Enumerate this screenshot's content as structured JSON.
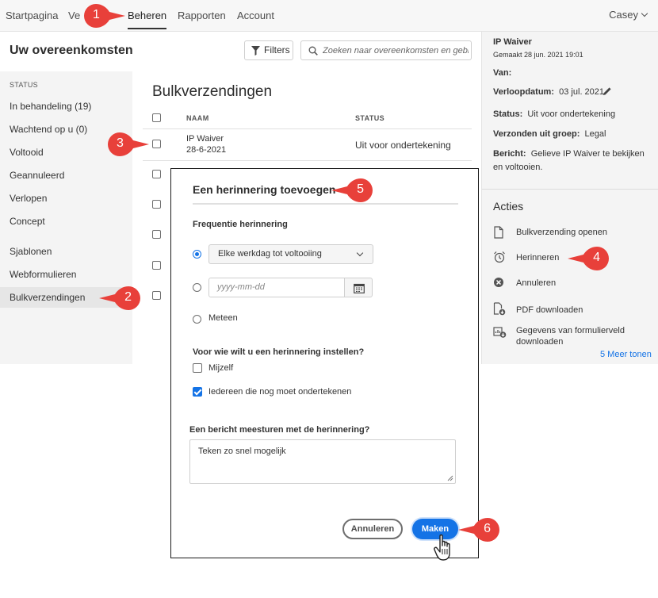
{
  "topnav": {
    "tabs": [
      "Startpagina",
      "Ve",
      "Beheren",
      "Rapporten",
      "Account"
    ],
    "active_tab": "Beheren",
    "user": "Casey"
  },
  "header": {
    "title": "Uw overeenkomsten",
    "filters_label": "Filters",
    "search_placeholder": "Zoeken naar overeenkomsten en gebr..."
  },
  "sidebar": {
    "section": "STATUS",
    "items": [
      "In behandeling (19)",
      "Wachtend op u (0)",
      "Voltooid",
      "Geannuleerd",
      "Verlopen",
      "Concept",
      "Sjablonen",
      "Webformulieren",
      "Bulkverzendingen"
    ],
    "selected": "Bulkverzendingen"
  },
  "table": {
    "title": "Bulkverzendingen",
    "columns": [
      "NAAM",
      "STATUS"
    ],
    "rows": [
      {
        "name": "IP Waiver",
        "date": "28-6-2021",
        "status": "Uit voor ondertekening"
      }
    ]
  },
  "details": {
    "title": "IP Waiver",
    "created": "Gemaakt 28 jun. 2021 19:01",
    "from_label": "Van:",
    "expiry_label": "Verloopdatum:",
    "expiry_value": "03 jul. 2021",
    "status_label": "Status:",
    "status_value": "Uit voor ondertekening",
    "group_label": "Verzonden uit groep:",
    "group_value": "Legal",
    "message_label": "Bericht:",
    "message_value": "Gelieve IP Waiver te bekijken en voltooien."
  },
  "actions": {
    "title": "Acties",
    "items": [
      "Bulkverzending openen",
      "Herinneren",
      "Annuleren",
      "PDF downloaden",
      "Gegevens van formulierveld downloaden"
    ],
    "more": "5 Meer tonen"
  },
  "dialog": {
    "title": "Een herinnering toevoegen",
    "frequency_label": "Frequentie herinnering",
    "frequency_selected": "Elke werkdag tot voltooiing",
    "date_placeholder": "yyyy-mm-dd",
    "option_now": "Meteen",
    "recipients_label": "Voor wie wilt u een herinnering instellen?",
    "recipient_self": "Mijzelf",
    "recipient_all": "Iedereen die nog moet ondertekenen",
    "self_checked": false,
    "all_checked": true,
    "message_label": "Een bericht meesturen met de herinnering?",
    "message_value": "Teken zo snel mogelijk",
    "cancel_label": "Annuleren",
    "make_label": "Maken"
  },
  "callouts": [
    "1",
    "2",
    "3",
    "4",
    "5",
    "6"
  ],
  "colors": {
    "accent": "#1473e6",
    "callout": "#e8403a"
  }
}
